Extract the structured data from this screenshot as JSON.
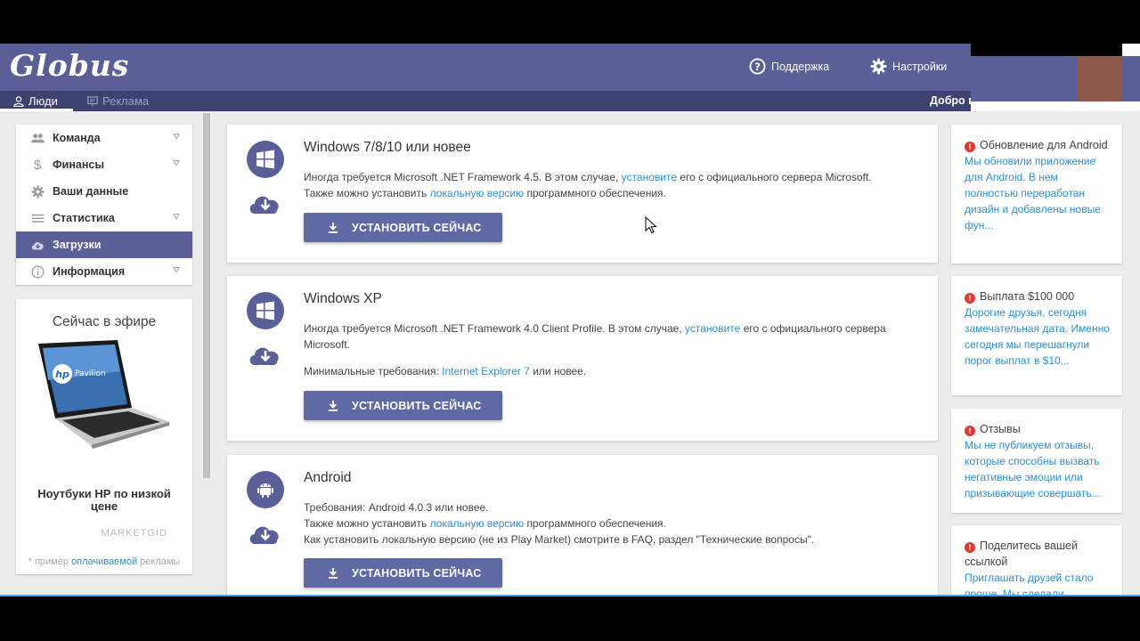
{
  "header": {
    "logo": "Globus",
    "support_label": "Поддержка",
    "settings_label": "Настройки",
    "welcome": "Добро п"
  },
  "subnav": {
    "people_label": "Люди",
    "ads_label": "Реклама"
  },
  "sidebar": {
    "items": [
      {
        "label": "Команда",
        "icon": "team-icon"
      },
      {
        "label": "Финансы",
        "icon": "dollar-icon"
      },
      {
        "label": "Ваши данные",
        "icon": "gear-icon"
      },
      {
        "label": "Статистика",
        "icon": "list-icon"
      },
      {
        "label": "Загрузки",
        "icon": "cloud-icon",
        "active": true
      },
      {
        "label": "Информация",
        "icon": "info-icon"
      }
    ]
  },
  "ad": {
    "title": "Сейчас в эфире",
    "product_brand": "Pavilion",
    "caption": "Ноутбуки HP по низкой цене",
    "brand": "MARKETGID",
    "note_prefix": "* пример",
    "note_link": "оплачиваемой",
    "note_suffix": "рекламы"
  },
  "downloads": [
    {
      "title": "Windows 7/8/10 или новее",
      "line1_a": "Иногда требуется Microsoft .NET Framework 4.5. В этом случае,",
      "line1_link": "установите",
      "line1_b": "его с официального сервера Microsoft.",
      "line2_a": "Также можно установить",
      "line2_link": "локальную версию",
      "line2_b": "программного обеспечения.",
      "button": "УСТАНОВИТЬ СЕЙЧАС"
    },
    {
      "title": "Windows XP",
      "line1_a": "Иногда требуется Microsoft .NET Framework 4.0 Client Profile. В этом случае,",
      "line1_link": "установите",
      "line1_b": "его с официального сервера Microsoft.",
      "req_a": "Минимальные требования:",
      "req_link": "Internet Explorer 7",
      "req_b": "или новее.",
      "button": "УСТАНОВИТЬ СЕЙЧАС"
    },
    {
      "title": "Android",
      "line1": "Требования: Android 4.0.3 или новее.",
      "line2_a": "Также можно установить",
      "line2_link": "локальную версию",
      "line2_b": "программного обеспечения.",
      "line3": "Как установить локальную версию (не из Play Market) смотрите в FAQ, раздел \"Технические вопросы\".",
      "button": "УСТАНОВИТЬ СЕЙЧАС"
    }
  ],
  "news": [
    {
      "title": "Обновление для Android",
      "body": "Мы обновили приложение для Android. В нем полностью переработан дизайн и добавлены новые фун..."
    },
    {
      "title": "Выплата $100 000",
      "body": "Дорогие друзья, сегодня замечательная дата. Именно сегодня мы перешагнули порог выплат в $10..."
    },
    {
      "title": "Отзывы",
      "body": "Мы не публикуем отзывы, которые способны вызвать негативные эмоции или призывающие совершать..."
    },
    {
      "title": "Поделитесь вашей ссылкой",
      "body": "Приглашать друзей стало проще. Мы сделали..."
    }
  ],
  "colors": {
    "header": "#5a5f97",
    "subbar": "#3d4270",
    "link": "#2d8fd5",
    "button": "#5f6aa5",
    "alert": "#e03b30"
  }
}
